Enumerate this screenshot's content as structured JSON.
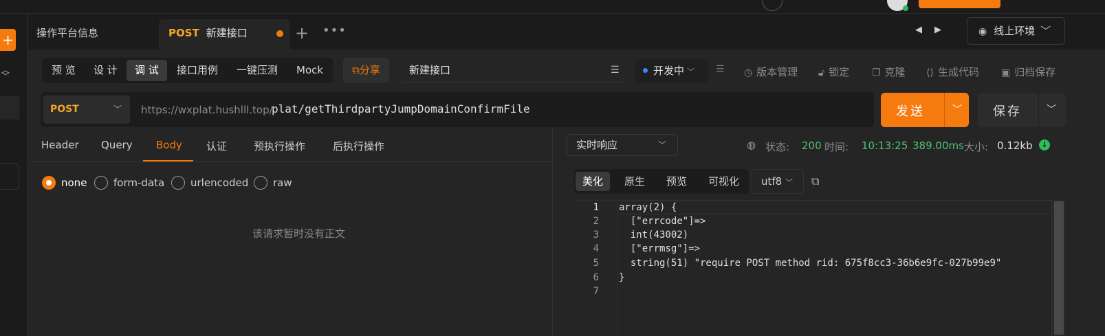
{
  "app": {
    "accent": "#f57b0f"
  },
  "tabs": {
    "info_label": "操作平台信息",
    "active": {
      "method": "POST",
      "name": "新建接口"
    },
    "environment": "线上环境"
  },
  "modes": [
    "预 览",
    "设 计",
    "调 试",
    "接口用例",
    "一键压测",
    "Mock"
  ],
  "active_mode": "调 试",
  "share_label": "分享",
  "api_name": "新建接口",
  "status": "开发中",
  "tools": [
    "版本管理",
    "锁定",
    "克隆",
    "生成代码",
    "归档保存"
  ],
  "request": {
    "method": "POST",
    "base_url": "https://wxplat.hushlll.top/",
    "path": "plat/getThirdpartyJumpDomainConfirmFile",
    "send_label": "发送",
    "save_label": "保存"
  },
  "request_tabs": [
    "Header",
    "Query",
    "Body",
    "认证",
    "预执行操作",
    "后执行操作"
  ],
  "active_request_tab": "Body",
  "body_types": [
    "none",
    "form-data",
    "urlencoded",
    "raw"
  ],
  "selected_body_type": "none",
  "empty_body_text": "该请求暂时没有正文",
  "response": {
    "mode": "实时响应",
    "status_label": "状态:",
    "status_code": "200",
    "time_label": "时间:",
    "time": "10:13:25",
    "duration": "389.00ms",
    "size_label": "大小:",
    "size": "0.12kb",
    "view_tabs": [
      "美化",
      "原生",
      "预览",
      "可视化"
    ],
    "active_view": "美化",
    "encoding": "utf8",
    "lines": [
      "array(2) {",
      "  [\"errcode\"]=>",
      "  int(43002)",
      "  [\"errmsg\"]=>",
      "  string(51) \"require POST method rid: 675f8cc3-36b6e9fc-027b99e9\"",
      "}",
      ""
    ]
  }
}
